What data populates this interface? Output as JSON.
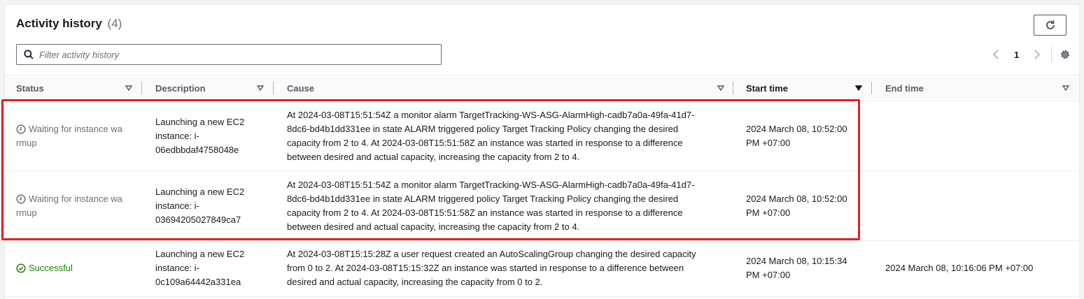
{
  "header": {
    "title": "Activity history",
    "count": "(4)"
  },
  "search": {
    "placeholder": "Filter activity history",
    "value": ""
  },
  "pagination": {
    "current_page": "1"
  },
  "table": {
    "columns": [
      {
        "label": "Status",
        "sort": "none"
      },
      {
        "label": "Description",
        "sort": "none"
      },
      {
        "label": "Cause",
        "sort": "none"
      },
      {
        "label": "Start time",
        "sort": "descending"
      },
      {
        "label": "End time",
        "sort": "none"
      }
    ],
    "rows": [
      {
        "status_line1": "Waiting for instance wa",
        "status_line2": "rmup",
        "status_type": "pending",
        "description_line1": "Launching a new EC2",
        "description_line2": "instance: i-",
        "description_line3": "06edbbdaf4758048e",
        "cause_line1": "At 2024-03-08T15:51:54Z a monitor alarm TargetTracking-WS-ASG-AlarmHigh-cadb7a0a-49fa-41d7-",
        "cause_line2": "8dc6-bd4b1dd331ee in state ALARM triggered policy Target Tracking Policy changing the desired",
        "cause_line3": "capacity from 2 to 4. At 2024-03-08T15:51:58Z an instance was started in response to a difference",
        "cause_line4": "between desired and actual capacity, increasing the capacity from 2 to 4.",
        "start_line1": "2024 March 08, 10:52:00",
        "start_line2": "PM +07:00",
        "end": ""
      },
      {
        "status_line1": "Waiting for instance wa",
        "status_line2": "rmup",
        "status_type": "pending",
        "description_line1": "Launching a new EC2",
        "description_line2": "instance: i-",
        "description_line3": "03694205027849ca7",
        "cause_line1": "At 2024-03-08T15:51:54Z a monitor alarm TargetTracking-WS-ASG-AlarmHigh-cadb7a0a-49fa-41d7-",
        "cause_line2": "8dc6-bd4b1dd331ee in state ALARM triggered policy Target Tracking Policy changing the desired",
        "cause_line3": "capacity from 2 to 4. At 2024-03-08T15:51:58Z an instance was started in response to a difference",
        "cause_line4": "between desired and actual capacity, increasing the capacity from 2 to 4.",
        "start_line1": "2024 March 08, 10:52:00",
        "start_line2": "PM +07:00",
        "end": ""
      },
      {
        "status_line1": "Successful",
        "status_line2": "",
        "status_type": "success",
        "description_line1": "Launching a new EC2",
        "description_line2": "instance: i-",
        "description_line3": "0c109a64442a331ea",
        "cause_line1": "At 2024-03-08T15:15:28Z a user request created an AutoScalingGroup changing the desired capacity",
        "cause_line2": "from 0 to 2. At 2024-03-08T15:15:32Z an instance was started in response to a difference between",
        "cause_line3": "desired and actual capacity, increasing the capacity from 0 to 2.",
        "cause_line4": "",
        "start_line1": "2024 March 08, 10:15:34",
        "start_line2": "PM +07:00",
        "end": "2024 March 08, 10:16:06 PM +07:00"
      }
    ]
  },
  "colors": {
    "highlight": "#e41f1f",
    "success": "#1d8102",
    "pending": "#687078"
  }
}
